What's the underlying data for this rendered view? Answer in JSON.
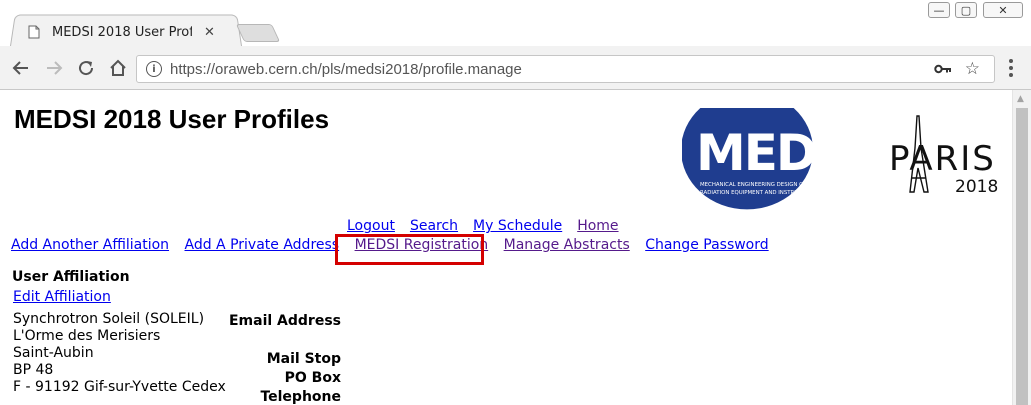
{
  "browser": {
    "tab_title": "MEDSI 2018 User Profiles",
    "tab_close": "✕",
    "url": "https://oraweb.cern.ch/pls/medsi2018/profile.manage",
    "window_controls": {
      "minimize": "—",
      "maximize": "▢",
      "close": "✕"
    },
    "icons": {
      "back": "arrow-left-icon",
      "forward": "arrow-right-icon",
      "reload": "reload-icon",
      "home": "home-icon",
      "info": "info-icon",
      "key": "key-icon",
      "star": "star-icon",
      "menu": "kebab-menu-icon"
    }
  },
  "page": {
    "title": "MEDSI 2018 User Profiles",
    "logo": {
      "main": "MEDSI",
      "line1": "MECHANICAL ENGINEERING DESIGN OF SYNCHROTRON",
      "line2": "RADIATION EQUIPMENT AND INSTRUMENTATION",
      "city": "PARIS",
      "year": "2018",
      "circle_color": "#1f3d8f"
    },
    "nav_row1": [
      "Logout",
      "Search",
      "My Schedule",
      "Home"
    ],
    "nav_row2": [
      "Add Another Affiliation",
      "Add A Private Address",
      "MEDSI Registration",
      "Manage Abstracts",
      "Change Password"
    ],
    "affiliation": {
      "heading": "User Affiliation",
      "edit_link": "Edit Affiliation",
      "address_lines": [
        "Synchrotron Soleil (SOLEIL)",
        "L'Orme des Merisiers",
        "Saint-Aubin",
        "BP 48",
        "F - 91192 Gif-sur-Yvette Cedex"
      ]
    },
    "fields": {
      "email_label": "Email Address",
      "mail_stop_label": "Mail Stop",
      "po_box_label": "PO Box",
      "telephone_label": "Telephone"
    },
    "highlight_color": "#d40000"
  }
}
